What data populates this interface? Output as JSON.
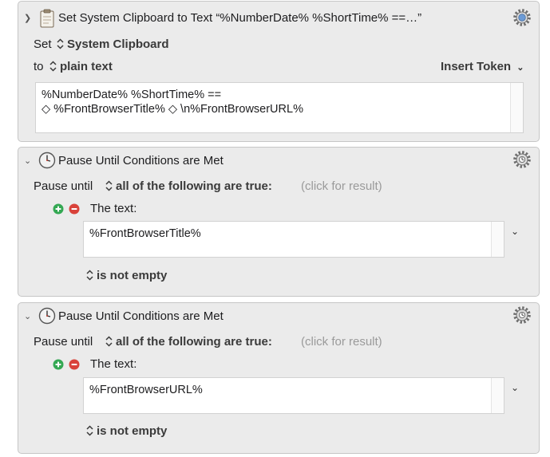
{
  "actions": [
    {
      "title": "Set System Clipboard to Text “%NumberDate% %ShortTime% ==…”",
      "set_label": "Set",
      "set_value": "System Clipboard",
      "to_label": "to",
      "to_value": "plain text",
      "insert_token": "Insert Token",
      "text_line1": "%NumberDate% %ShortTime% ==",
      "text_line2": "◇ %FrontBrowserTitle% ◇ \\n%FrontBrowserURL%"
    },
    {
      "title": "Pause Until Conditions are Met",
      "pause_label": "Pause until",
      "condition_mode": "all of the following are true:",
      "result_hint": "(click for result)",
      "condition_label": "The text:",
      "condition_text": "%FrontBrowserTitle%",
      "condition_test": "is not empty"
    },
    {
      "title": "Pause Until Conditions are Met",
      "pause_label": "Pause until",
      "condition_mode": "all of the following are true:",
      "result_hint": "(click for result)",
      "condition_label": "The text:",
      "condition_text": "%FrontBrowserURL%",
      "condition_test": "is not empty"
    }
  ],
  "icons": {
    "disclosure": "disclosure-triangle-icon",
    "clipboard": "clipboard-icon",
    "clock": "clock-icon",
    "gear": "gear-icon",
    "add": "add-condition-icon",
    "remove": "remove-condition-icon"
  },
  "colors": {
    "panel": "#ebebeb",
    "add": "#34a853",
    "remove": "#d9423a",
    "hint": "#9a9a9a"
  }
}
